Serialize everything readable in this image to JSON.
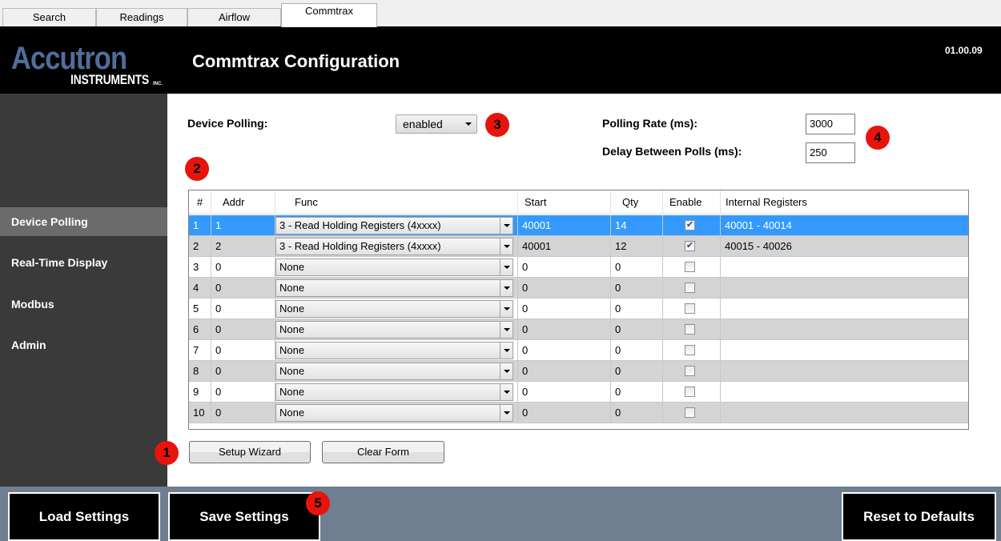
{
  "tabs": [
    {
      "label": "Search"
    },
    {
      "label": "Readings"
    },
    {
      "label": "Airflow"
    },
    {
      "label": "Commtrax"
    }
  ],
  "header": {
    "logo_main": "Accutron",
    "logo_sub": "INSTRUMENTS",
    "logo_inc": "INC.",
    "title": "Commtrax Configuration",
    "version": "01.00.09"
  },
  "sidebar": {
    "items": [
      {
        "label": "Device Polling"
      },
      {
        "label": "Real-Time Display"
      },
      {
        "label": "Modbus"
      },
      {
        "label": "Admin"
      }
    ]
  },
  "polling": {
    "device_polling_label": "Device Polling:",
    "device_polling_value": "enabled",
    "rate_label": "Polling Rate (ms):",
    "rate_value": "3000",
    "delay_label": "Delay Between Polls (ms):",
    "delay_value": "250"
  },
  "grid": {
    "headers": [
      "#",
      "Addr",
      "Func",
      "Start",
      "Qty",
      "Enable",
      "Internal Registers"
    ],
    "rows": [
      {
        "num": "1",
        "addr": "1",
        "func": "3 - Read Holding Registers (4xxxx)",
        "start": "40001",
        "qty": "14",
        "enabled": true,
        "registers": "40001 - 40014"
      },
      {
        "num": "2",
        "addr": "2",
        "func": "3 - Read Holding Registers (4xxxx)",
        "start": "40001",
        "qty": "12",
        "enabled": true,
        "registers": "40015 - 40026"
      },
      {
        "num": "3",
        "addr": "0",
        "func": "None",
        "start": "0",
        "qty": "0",
        "enabled": false,
        "registers": ""
      },
      {
        "num": "4",
        "addr": "0",
        "func": "None",
        "start": "0",
        "qty": "0",
        "enabled": false,
        "registers": ""
      },
      {
        "num": "5",
        "addr": "0",
        "func": "None",
        "start": "0",
        "qty": "0",
        "enabled": false,
        "registers": ""
      },
      {
        "num": "6",
        "addr": "0",
        "func": "None",
        "start": "0",
        "qty": "0",
        "enabled": false,
        "registers": ""
      },
      {
        "num": "7",
        "addr": "0",
        "func": "None",
        "start": "0",
        "qty": "0",
        "enabled": false,
        "registers": ""
      },
      {
        "num": "8",
        "addr": "0",
        "func": "None",
        "start": "0",
        "qty": "0",
        "enabled": false,
        "registers": ""
      },
      {
        "num": "9",
        "addr": "0",
        "func": "None",
        "start": "0",
        "qty": "0",
        "enabled": false,
        "registers": ""
      },
      {
        "num": "10",
        "addr": "0",
        "func": "None",
        "start": "0",
        "qty": "0",
        "enabled": false,
        "registers": ""
      }
    ]
  },
  "buttons": {
    "setup_wizard": "Setup Wizard",
    "clear_form": "Clear Form"
  },
  "footer": {
    "load": "Load Settings",
    "save": "Save Settings",
    "reset": "Reset to Defaults"
  },
  "badges": {
    "b1": "1",
    "b2": "2",
    "b3": "3",
    "b4": "4",
    "b5": "5"
  },
  "colors": {
    "selected_row": "#3399ff",
    "alt_row": "#d4d4d4",
    "badge": "#e8140c",
    "sidebar": "#3a3a3a",
    "footer": "#6f7f8f"
  }
}
